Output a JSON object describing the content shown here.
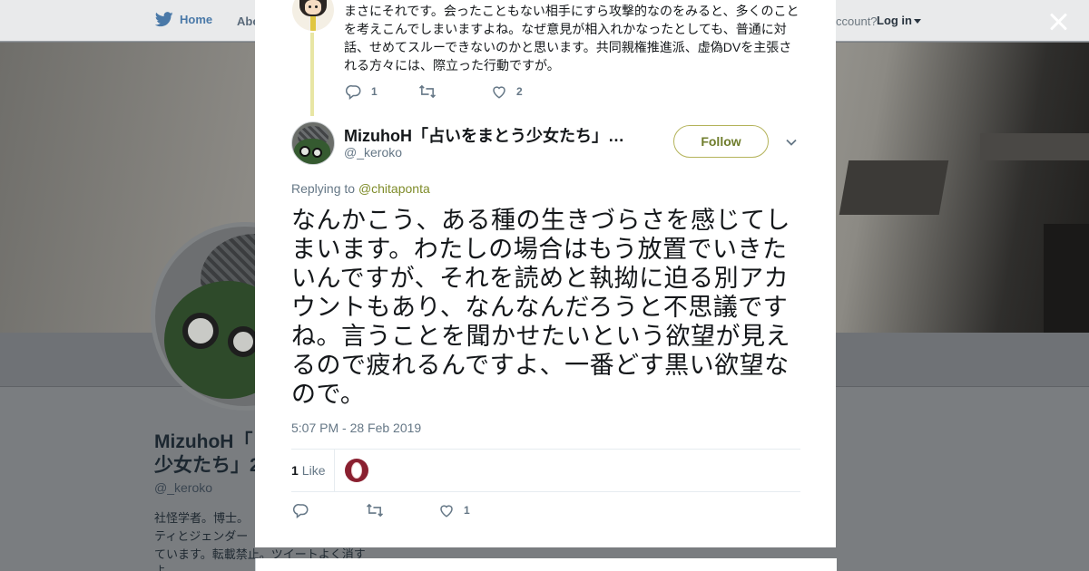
{
  "nav": {
    "home_label": "Home",
    "about_label": "Abo",
    "account_text": "ccount?",
    "login_label": "Log in"
  },
  "profile": {
    "name_line1": "MizuhoH「占",
    "name_line2": "少女たち」2",
    "handle": "@_keroko",
    "bio_line1": "社怪学者。博士。",
    "bio_line2": "ティとジェンダー",
    "bio_line3": "ています。転載禁止。ツイートよく消す",
    "bio_line4": "よ。"
  },
  "parent_tweet": {
    "text": "まさにそれです。会ったこともない相手にすら攻撃的なのをみると、多くのことを考えこんでしまいますよね。なぜ意見が相入れかなったとしても、普通に対話、せめてスルーできないのかと思います。共同親権推進派、虚偽DVを主張される方々には、際立った行動ですが。",
    "reply_count": "1",
    "like_count": "2"
  },
  "tweet": {
    "author_name": "MizuhoH「占いをまとう少女たち」…",
    "author_handle": "@_keroko",
    "follow_label": "Follow",
    "replying_prefix": "Replying to",
    "replying_to": "@chitaponta",
    "text": "なんかこう、ある種の生きづらさを感じてしまいます。わたしの場合はもう放置でいきたいんですが、それを読めと執拗に迫る別アカウントもあり、なんなんだろうと不思議ですね。言うことを聞かせたいという欲望が見えるので疲れるんですよ、一番どす黒い欲望なので。",
    "timestamp": "5:07 PM - 28 Feb 2019",
    "like_count": "1",
    "like_label": "Like",
    "action_like_count": "1"
  },
  "colors": {
    "accent_green": "#b4b35a",
    "mention": "#7f8c2a",
    "thread_line": "#e8e6a4",
    "text_primary": "#14171a",
    "text_secondary": "#657786",
    "twitter_blue": "#4a79a8"
  },
  "icons": [
    "twitter-bird-icon",
    "close-icon",
    "reply-icon",
    "retweet-icon",
    "heart-icon",
    "chevron-down-icon"
  ]
}
